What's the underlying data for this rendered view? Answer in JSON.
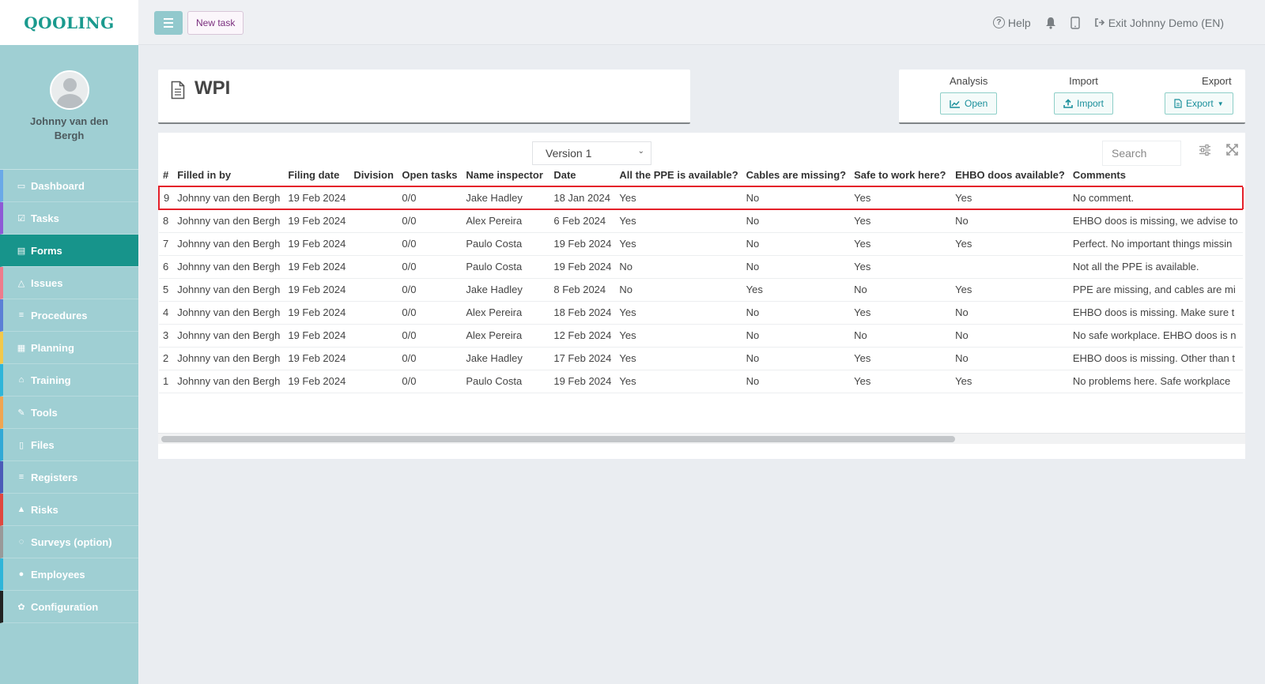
{
  "app": {
    "logo": "QOOLING"
  },
  "sidebar": {
    "user_name": "Johnny van den Bergh",
    "items": [
      {
        "label": "Dashboard",
        "icon": "monitor-icon",
        "glyph": "▭",
        "color": "#6aa9e8"
      },
      {
        "label": "Tasks",
        "icon": "checkbox-icon",
        "glyph": "☑",
        "color": "#8e5ad6"
      },
      {
        "label": "Forms",
        "icon": "document-icon",
        "glyph": "▤",
        "color": "#17948b",
        "active": true
      },
      {
        "label": "Issues",
        "icon": "bell-icon",
        "glyph": "△",
        "color": "#ee7b8c"
      },
      {
        "label": "Procedures",
        "icon": "list-icon",
        "glyph": "≡",
        "color": "#5b7fd6"
      },
      {
        "label": "Planning",
        "icon": "calendar-icon",
        "glyph": "▦",
        "color": "#f2c84b"
      },
      {
        "label": "Training",
        "icon": "graduation-cap-icon",
        "glyph": "⌂",
        "color": "#2fb5d9"
      },
      {
        "label": "Tools",
        "icon": "wrench-icon",
        "glyph": "✎",
        "color": "#f0a552"
      },
      {
        "label": "Files",
        "icon": "file-pdf-icon",
        "glyph": "▯",
        "color": "#31a9d6"
      },
      {
        "label": "Registers",
        "icon": "list-icon",
        "glyph": "≡",
        "color": "#4b5bb8"
      },
      {
        "label": "Risks",
        "icon": "warning-icon",
        "glyph": "▲",
        "color": "#e0473e"
      },
      {
        "label": "Surveys (option)",
        "icon": "comments-icon",
        "glyph": "◌",
        "color": "#999999"
      },
      {
        "label": "Employees",
        "icon": "users-icon",
        "glyph": "●",
        "color": "#2fb5d9"
      },
      {
        "label": "Configuration",
        "icon": "gear-icon",
        "glyph": "✿",
        "color": "#222222"
      }
    ]
  },
  "topbar": {
    "new_task": "New task",
    "help": "Help",
    "exit": "Exit Johnny Demo (EN)"
  },
  "page": {
    "title": "WPI"
  },
  "actions": {
    "analysis": {
      "label": "Analysis",
      "button": "Open"
    },
    "import": {
      "label": "Import",
      "button": "Import"
    },
    "export": {
      "label": "Export",
      "button": "Export"
    }
  },
  "table": {
    "version": "Version 1",
    "search_placeholder": "Search",
    "columns": [
      "#",
      "Filled in by",
      "Filing date",
      "Division",
      "Open tasks",
      "Name inspector",
      "Date",
      "All the PPE is available?",
      "Cables are missing?",
      "Safe to work here?",
      "EHBO doos available?",
      "Comments"
    ],
    "rows": [
      [
        "9",
        "Johnny van den Bergh",
        "19 Feb 2024",
        "",
        "0/0",
        "Jake Hadley",
        "18 Jan 2024",
        "Yes",
        "No",
        "Yes",
        "Yes",
        "No comment."
      ],
      [
        "8",
        "Johnny van den Bergh",
        "19 Feb 2024",
        "",
        "0/0",
        "Alex Pereira",
        "6 Feb 2024",
        "Yes",
        "No",
        "Yes",
        "No",
        "EHBO doos is missing, we advise to"
      ],
      [
        "7",
        "Johnny van den Bergh",
        "19 Feb 2024",
        "",
        "0/0",
        "Paulo Costa",
        "19 Feb 2024",
        "Yes",
        "No",
        "Yes",
        "Yes",
        "Perfect. No important things missin"
      ],
      [
        "6",
        "Johnny van den Bergh",
        "19 Feb 2024",
        "",
        "0/0",
        "Paulo Costa",
        "19 Feb 2024",
        "No",
        "No",
        "Yes",
        "",
        "Not all the PPE is available."
      ],
      [
        "5",
        "Johnny van den Bergh",
        "19 Feb 2024",
        "",
        "0/0",
        "Jake Hadley",
        "8 Feb 2024",
        "No",
        "Yes",
        "No",
        "Yes",
        "PPE are missing, and cables are mi"
      ],
      [
        "4",
        "Johnny van den Bergh",
        "19 Feb 2024",
        "",
        "0/0",
        "Alex Pereira",
        "18 Feb 2024",
        "Yes",
        "No",
        "Yes",
        "No",
        "EHBO doos is missing. Make sure t"
      ],
      [
        "3",
        "Johnny van den Bergh",
        "19 Feb 2024",
        "",
        "0/0",
        "Alex Pereira",
        "12 Feb 2024",
        "Yes",
        "No",
        "No",
        "No",
        "No safe workplace. EHBO doos is n"
      ],
      [
        "2",
        "Johnny van den Bergh",
        "19 Feb 2024",
        "",
        "0/0",
        "Jake Hadley",
        "17 Feb 2024",
        "Yes",
        "No",
        "Yes",
        "No",
        "EHBO doos is missing. Other than t"
      ],
      [
        "1",
        "Johnny van den Bergh",
        "19 Feb 2024",
        "",
        "0/0",
        "Paulo Costa",
        "19 Feb 2024",
        "Yes",
        "No",
        "Yes",
        "Yes",
        "No problems here. Safe workplace"
      ]
    ],
    "highlighted_row": 0
  },
  "colors": {
    "accent": "#17948b",
    "sidebar": "#9fcfd3",
    "highlight": "#e4202a"
  }
}
